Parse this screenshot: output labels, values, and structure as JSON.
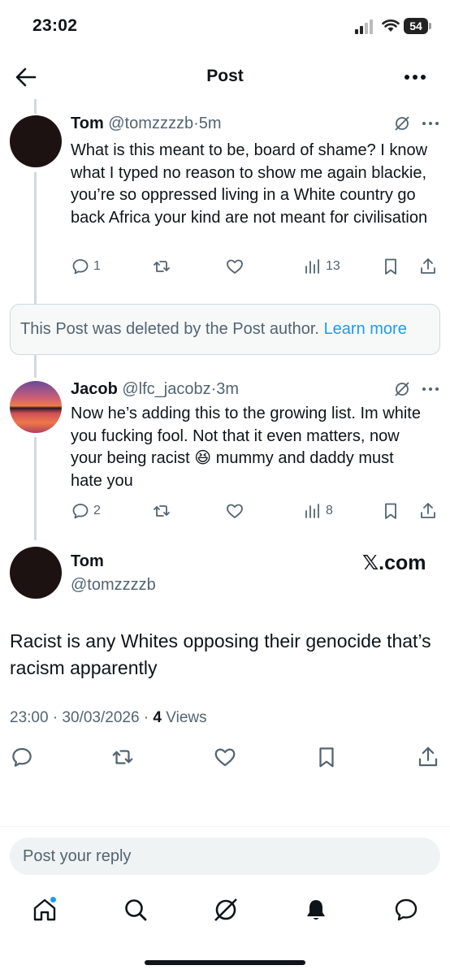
{
  "status_bar": {
    "time": "23:02",
    "battery": "54"
  },
  "header": {
    "title": "Post"
  },
  "posts": [
    {
      "name": "Tom",
      "handle": "@tomzzzzb",
      "time": "5m",
      "text": "What is this meant to be, board of shame? I know what I typed no reason to show me again blackie, you’re so oppressed living in a White country go back Africa your kind are not meant for civilisation",
      "replies": "1",
      "views": "13"
    },
    {
      "name": "Jacob",
      "handle": "@lfc_jacobz",
      "time": "3m",
      "text": "Now he’s adding this to the growing list.  Im white you fucking fool.  Not that it even matters, now your being racist 😆 mummy and daddy must hate you",
      "replies": "2",
      "views": "8"
    }
  ],
  "deleted_notice": {
    "text": "This Post was deleted by the Post author.",
    "link": "Learn more"
  },
  "main_post": {
    "name": "Tom",
    "handle": "@tomzzzzb",
    "watermark": "𝕏.com",
    "text": "Racist is any Whites opposing their genocide that’s racism apparently",
    "timestamp": "23:00 · 30/03/2026 · ",
    "views_count": "4",
    "views_label": " Views"
  },
  "reply_box": {
    "placeholder": "Post your reply"
  },
  "tabbar": {
    "items": [
      "home",
      "search",
      "grok",
      "notifications",
      "messages"
    ]
  },
  "colors": {
    "accent": "#1d9bf0",
    "muted": "#536471",
    "text": "#0f1419"
  }
}
